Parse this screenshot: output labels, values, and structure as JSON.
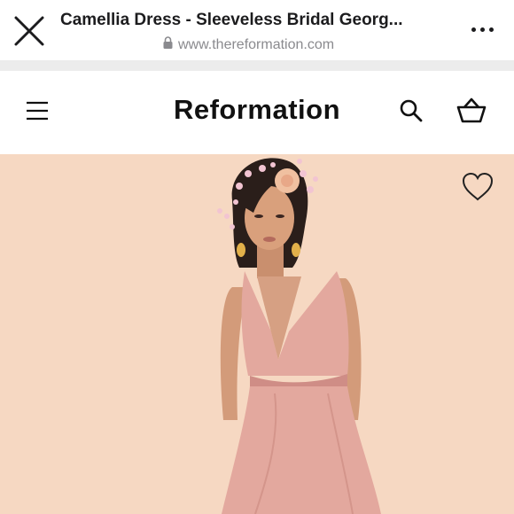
{
  "browser": {
    "title": "Camellia Dress - Sleeveless Bridal Georg...",
    "url": "www.thereformation.com"
  },
  "site": {
    "brand": "Reformation"
  },
  "icons": {
    "close": "close-icon",
    "lock": "lock-icon",
    "more": "more-icon",
    "menu": "hamburger-menu-icon",
    "search": "search-icon",
    "cart": "shopping-basket-icon",
    "wishlist": "heart-icon"
  },
  "colors": {
    "hero_background": "#f6d8c2",
    "dress": "#e3a89e",
    "text": "#111111",
    "url_gray": "#8a8a8e"
  }
}
